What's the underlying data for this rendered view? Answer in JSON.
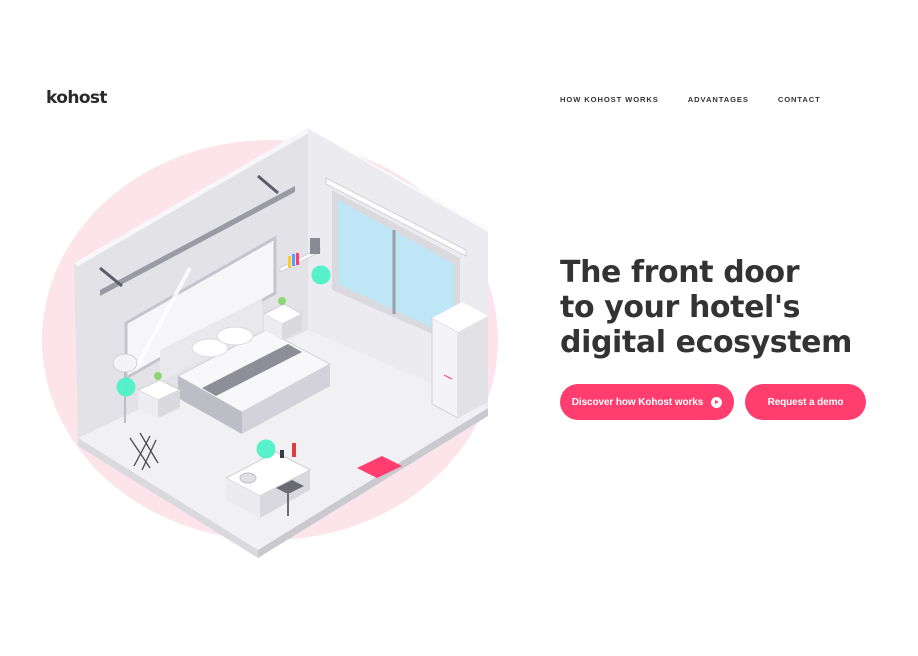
{
  "brand": {
    "logo_text": "kohost"
  },
  "nav": {
    "items": [
      {
        "label": "HOW KOHOST WORKS"
      },
      {
        "label": "ADVANTAGES"
      },
      {
        "label": "CONTACT"
      }
    ]
  },
  "hero": {
    "title_lines": [
      "The front door",
      "to your hotel's",
      "digital ecosystem"
    ],
    "primary_button": {
      "label": "Discover how Kohost works",
      "icon": "play-circle-icon"
    },
    "secondary_button": {
      "label": "Request a demo"
    }
  },
  "colors": {
    "accent": "#ff3d6e",
    "blob": "#fde4ea",
    "sensor": "#4ef0c8",
    "text": "#333333"
  }
}
